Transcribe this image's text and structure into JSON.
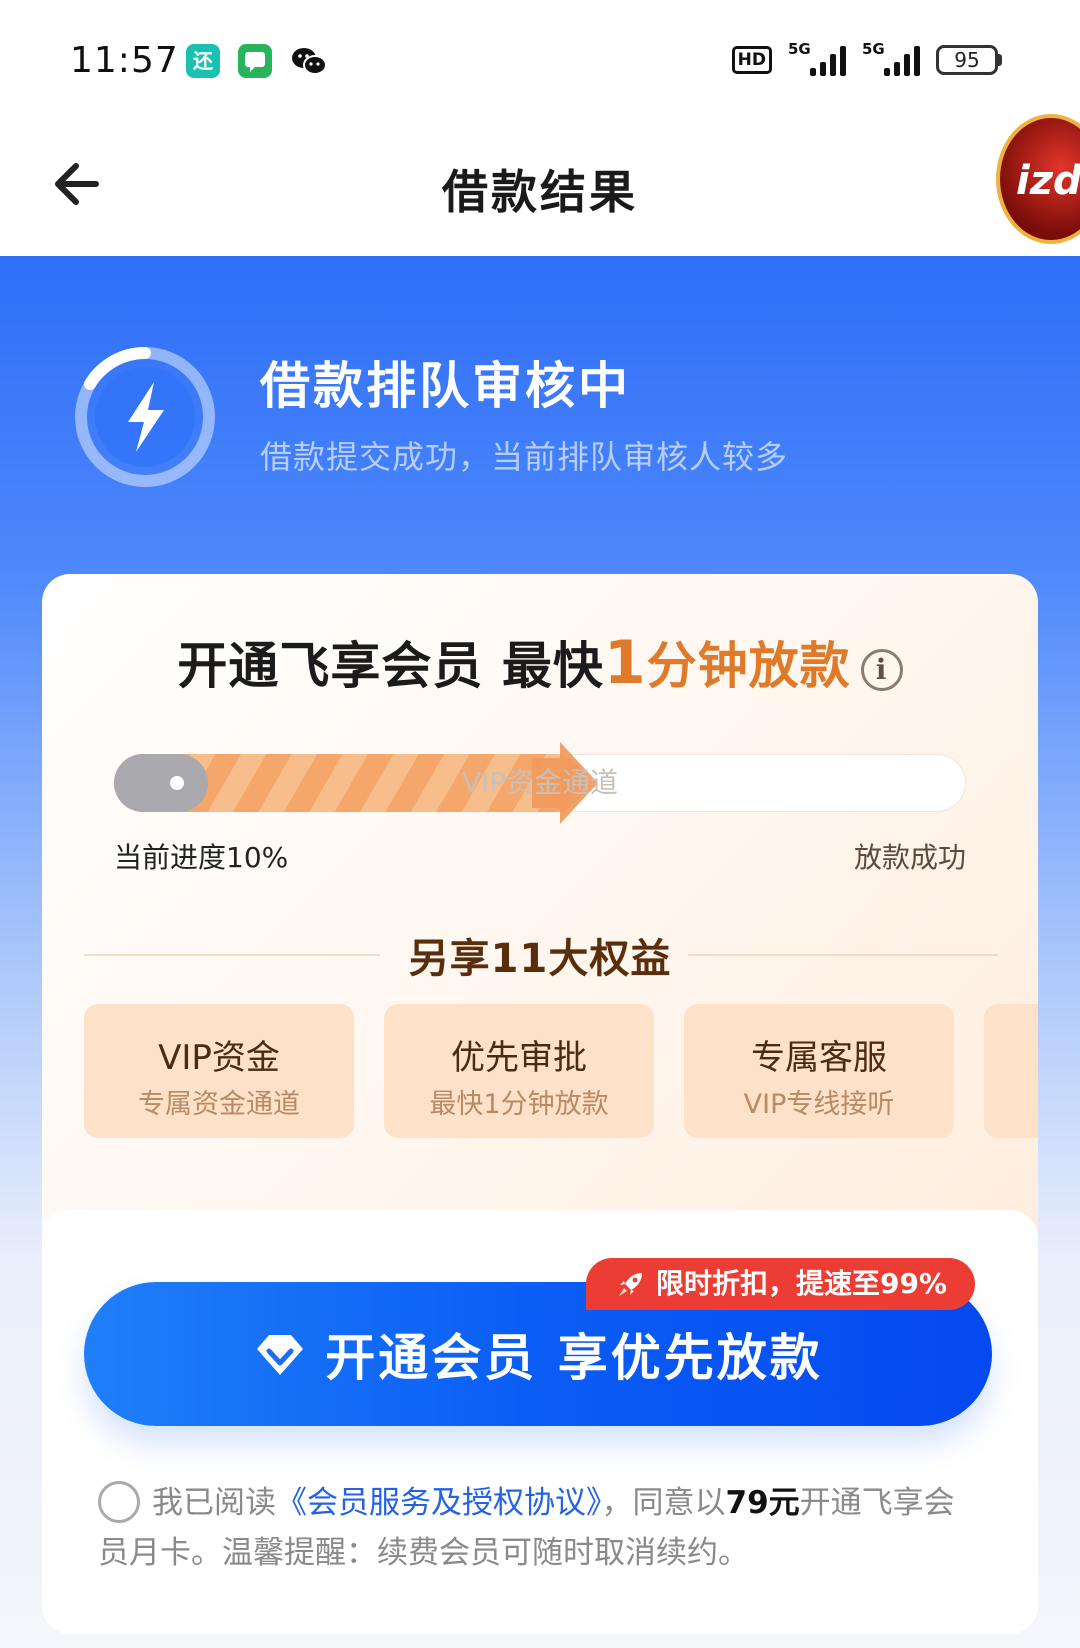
{
  "status_bar": {
    "time": "11:57",
    "app_icon_1_text": "还",
    "hd_label": "HD",
    "signal_1_label": "5G",
    "signal_2_label": "5G",
    "battery": "95"
  },
  "nav": {
    "title": "借款结果",
    "badge_text": "izd"
  },
  "hero": {
    "title": "借款排队审核中",
    "subtitle": "借款提交成功，当前排队审核人较多"
  },
  "card": {
    "title_prefix": "开通飞享会员 最快",
    "title_number": "1",
    "title_suffix": "分钟放款",
    "info_glyph": "i",
    "progress": {
      "percent": 10,
      "lane_label": "VIP资金通道",
      "left_label": "当前进度10%",
      "right_label": "放款成功"
    },
    "benefits_title": "另享11大权益",
    "benefits": [
      {
        "title": "VIP资金",
        "subtitle": "专属资金通道"
      },
      {
        "title": "优先审批",
        "subtitle": "最快1分钟放款"
      },
      {
        "title": "专属客服",
        "subtitle": "VIP专线接听"
      }
    ]
  },
  "cta": {
    "promo_label": "限时折扣，提速至99%",
    "button_label": "开通会员 享优先放款"
  },
  "agreement": {
    "prefix": "我已阅读",
    "link": "《会员服务及授权协议》",
    "middle": "，同意以",
    "price": "79元",
    "suffix": "开通飞享会员月卡。温馨提醒：续费会员可随时取消续约。"
  },
  "colors": {
    "primary_blue": "#1f6bf6",
    "accent_orange": "#e07a2b",
    "promo_red": "#ec3d35"
  }
}
